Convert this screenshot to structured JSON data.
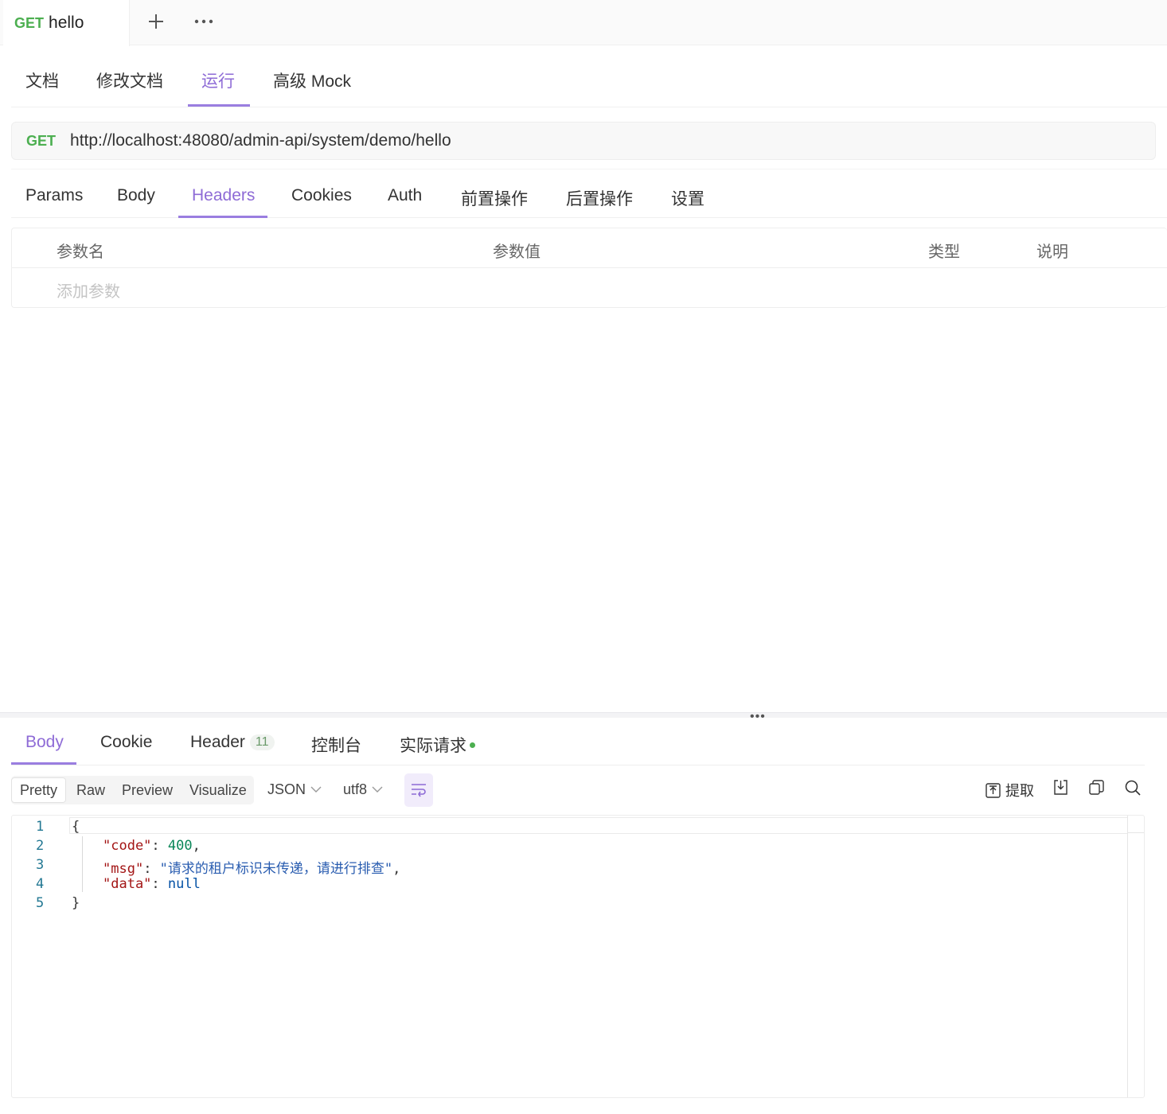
{
  "top_tab": {
    "method": "GET",
    "name": "hello"
  },
  "mode_tabs": [
    "文档",
    "修改文档",
    "运行",
    "高级 Mock"
  ],
  "url_bar": {
    "method": "GET",
    "url": "http://localhost:48080/admin-api/system/demo/hello"
  },
  "request_tabs": [
    "Params",
    "Body",
    "Headers",
    "Cookies",
    "Auth",
    "前置操作",
    "后置操作",
    "设置"
  ],
  "params_table": {
    "columns": [
      "参数名",
      "参数值",
      "类型",
      "说明"
    ],
    "add_placeholder": "添加参数"
  },
  "response_tabs": {
    "body": "Body",
    "cookie": "Cookie",
    "header": "Header",
    "header_count": "11",
    "console": "控制台",
    "actual_request": "实际请求"
  },
  "view_modes": [
    "Pretty",
    "Raw",
    "Preview",
    "Visualize"
  ],
  "format": "JSON",
  "encoding": "utf8",
  "extract_label": "提取",
  "code": {
    "line_numbers": [
      "1",
      "2",
      "3",
      "4",
      "5"
    ],
    "open_brace": "{",
    "close_brace": "}",
    "code_key": "\"code\"",
    "code_value": "400",
    "msg_key": "\"msg\"",
    "msg_value": "\"请求的租户标识未传递，请进行排查\"",
    "data_key": "\"data\"",
    "data_value": "null"
  },
  "colors": {
    "accent": "#8e6bd6",
    "get": "#4caf50"
  }
}
